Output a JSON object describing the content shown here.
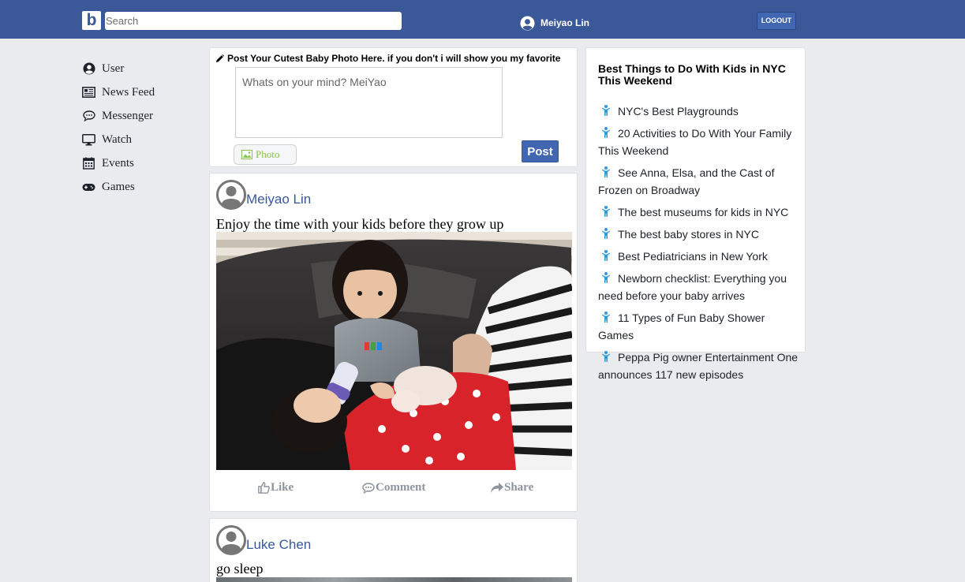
{
  "header": {
    "logo_letter": "b",
    "search_placeholder": "Search",
    "user_name": "Meiyao Lin",
    "logout_label": "LOGOUT"
  },
  "nav": {
    "items": [
      {
        "label": "User",
        "icon": "user-circle-icon"
      },
      {
        "label": "News Feed",
        "icon": "newspaper-icon"
      },
      {
        "label": "Messenger",
        "icon": "chat-bubble-icon"
      },
      {
        "label": "Watch",
        "icon": "monitor-icon"
      },
      {
        "label": "Events",
        "icon": "calendar-icon"
      },
      {
        "label": "Games",
        "icon": "gamepad-icon"
      }
    ]
  },
  "composer": {
    "title": "Post Your Cutest Baby Photo Here. if you don't i will show you my favorite",
    "placeholder": "Whats on your mind? MeiYao",
    "photo_label": "Photo",
    "post_label": "Post"
  },
  "posts": [
    {
      "author": "Meiyao Lin",
      "text": "Enjoy the time with your kids before they grow up",
      "actions": {
        "like": "Like",
        "comment": "Comment",
        "share": "Share"
      }
    },
    {
      "author": "Luke Chen",
      "text": "go sleep"
    }
  ],
  "sidebar": {
    "title": "Best Things to Do With Kids in NYC This Weekend",
    "items": [
      "NYC's Best Playgrounds",
      "20 Activities to Do With Your Family This Weekend",
      "See Anna, Elsa, and the Cast of Frozen on Broadway",
      "The best museums for kids in NYC",
      "The best baby stores in NYC",
      "Best Pediatricians in New York",
      "Newborn checklist: Everything you need before your baby arrives",
      "11 Types of Fun Baby Shower Games",
      "Peppa Pig owner Entertainment One announces 117 new episodes"
    ]
  },
  "colors": {
    "brand": "#3b5998",
    "link": "#365899",
    "post_button": "#4267b2",
    "photo_green": "#8bc34a",
    "child_icon": "#2d9cdb"
  }
}
